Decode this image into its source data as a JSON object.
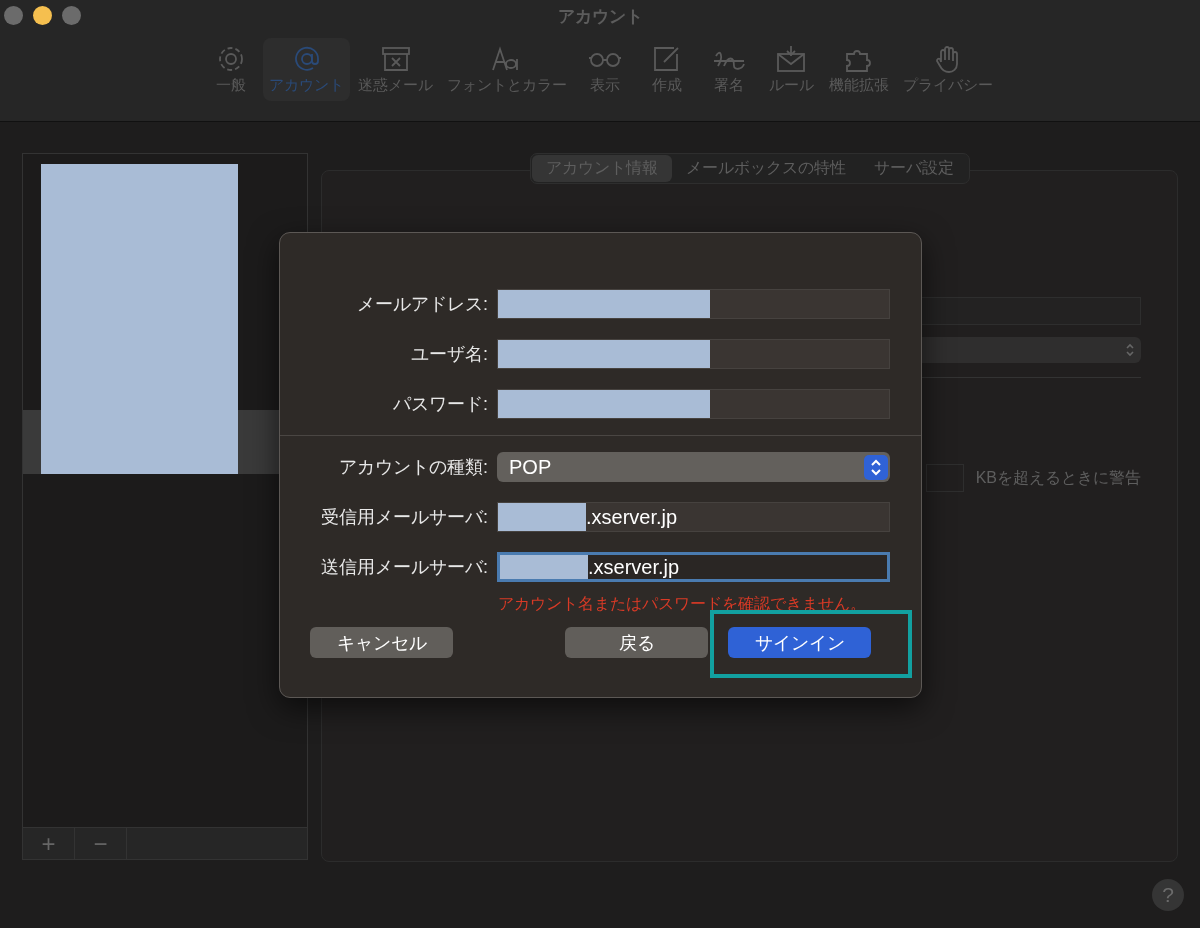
{
  "window": {
    "title": "アカウント"
  },
  "window_controls": [
    {
      "color": "#6b6b6b"
    },
    {
      "color": "#f5bf4f"
    },
    {
      "color": "#6b6b6b"
    }
  ],
  "toolbar": [
    {
      "label": "一般",
      "kind": "gear",
      "selected": false
    },
    {
      "label": "アカウント",
      "kind": "at",
      "selected": true
    },
    {
      "label": "迷惑メール",
      "kind": "junk",
      "selected": false
    },
    {
      "label": "フォントとカラー",
      "kind": "font",
      "selected": false
    },
    {
      "label": "表示",
      "kind": "glasses",
      "selected": false
    },
    {
      "label": "作成",
      "kind": "compose",
      "selected": false
    },
    {
      "label": "署名",
      "kind": "signature",
      "selected": false
    },
    {
      "label": "ルール",
      "kind": "rules",
      "selected": false
    },
    {
      "label": "機能拡張",
      "kind": "puzzle",
      "selected": false
    },
    {
      "label": "プライバシー",
      "kind": "hand",
      "selected": false
    }
  ],
  "account_list": {
    "redacted": true,
    "rows": [
      {
        "selected": false
      },
      {
        "selected": false
      },
      {
        "selected": false
      },
      {
        "selected": false
      },
      {
        "selected": true
      }
    ],
    "buttons": [
      "+",
      "−"
    ]
  },
  "tabs": [
    {
      "label": "アカウント情報",
      "selected": true
    },
    {
      "label": "メールボックスの特性",
      "selected": false
    },
    {
      "label": "サーバ設定",
      "selected": false
    }
  ],
  "background_form": {
    "size_warning": "KBを超えるときに警告"
  },
  "dialog": {
    "sections": [
      [
        {
          "label": "メールアドレス:",
          "kind": "text",
          "redacted": true,
          "focused": false
        },
        {
          "label": "ユーザ名:",
          "kind": "text",
          "redacted": true,
          "focused": false
        },
        {
          "label": "パスワード:",
          "kind": "text",
          "redacted": true,
          "focused": false
        }
      ],
      [
        {
          "label": "アカウントの種類:",
          "kind": "popup",
          "value": "POP"
        },
        {
          "label": "受信用メールサーバ:",
          "kind": "text",
          "redacted": true,
          "value": ".xserver.jp",
          "focused": false
        },
        {
          "label": "送信用メールサーバ:",
          "kind": "text",
          "redacted": true,
          "value": ".xserver.jp",
          "focused": true
        }
      ]
    ],
    "error": "アカウント名またはパスワードを確認できません。",
    "buttons": [
      {
        "label": "キャンセル",
        "kind": "secondary"
      },
      {
        "label": "戻る",
        "kind": "secondary"
      },
      {
        "label": "サインイン",
        "kind": "primary",
        "highlighted": true
      }
    ]
  },
  "help": "?"
}
